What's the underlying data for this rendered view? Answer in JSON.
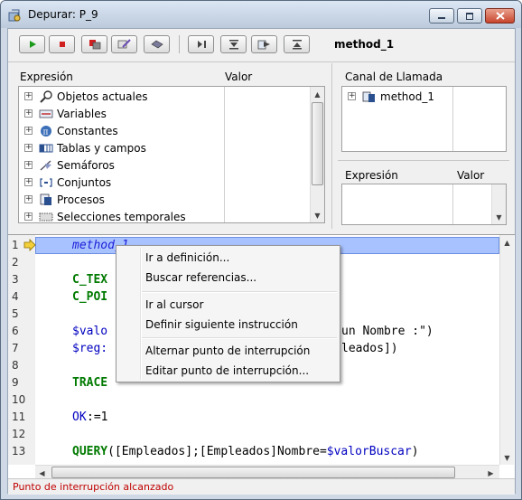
{
  "window": {
    "title": "Depurar: P_9"
  },
  "toolbar": {
    "method_label": "method_1",
    "buttons": [
      "run-icon",
      "stop-icon",
      "abort-icon",
      "edit-icon",
      "trace-icon",
      "step-over-icon",
      "step-into-icon",
      "step-method-icon",
      "step-out-icon"
    ]
  },
  "expressions": {
    "header_expr": "Expresión",
    "header_value": "Valor",
    "items": [
      {
        "label": "Objetos actuales"
      },
      {
        "label": "Variables"
      },
      {
        "label": "Constantes"
      },
      {
        "label": "Tablas y campos"
      },
      {
        "label": "Semáforos"
      },
      {
        "label": "Conjuntos"
      },
      {
        "label": "Procesos"
      },
      {
        "label": "Selecciones temporales"
      }
    ]
  },
  "callchain": {
    "header": "Canal de Llamada",
    "items": [
      {
        "label": "method_1"
      }
    ]
  },
  "custom_watch": {
    "header_expr": "Expresión",
    "header_value": "Valor"
  },
  "editor": {
    "line_numbers": [
      "1",
      "2",
      "3",
      "4",
      "5",
      "6",
      "7",
      "8",
      "9",
      "10",
      "11",
      "12",
      "13"
    ],
    "lines": {
      "l1": "method_1",
      "l4a": "C_TEX",
      "l5a": "C_POI",
      "l7a": "$valo",
      "l7b": "un Nombre :\")",
      "l8a": "$reg:",
      "l8b": "leados])",
      "l10a": "TRACE",
      "l12a": "OK",
      "l12b": ":=1",
      "l14a": "QUERY",
      "l14b": "([Empleados];[Empleados]Nombre=",
      "l14c": "$valorBuscar",
      "l14d": ")"
    }
  },
  "context_menu": {
    "items": [
      "Ir a definición...",
      "Buscar referencias...",
      "Ir al cursor",
      "Definir siguiente instrucción",
      "Alternar punto de interrupción",
      "Editar punto de interrupción..."
    ]
  },
  "status": {
    "text": "Punto de interrupción alcanzado"
  },
  "colors": {
    "highlight": "#a8c2ff",
    "command": "#007a00",
    "status": "#c00000"
  }
}
